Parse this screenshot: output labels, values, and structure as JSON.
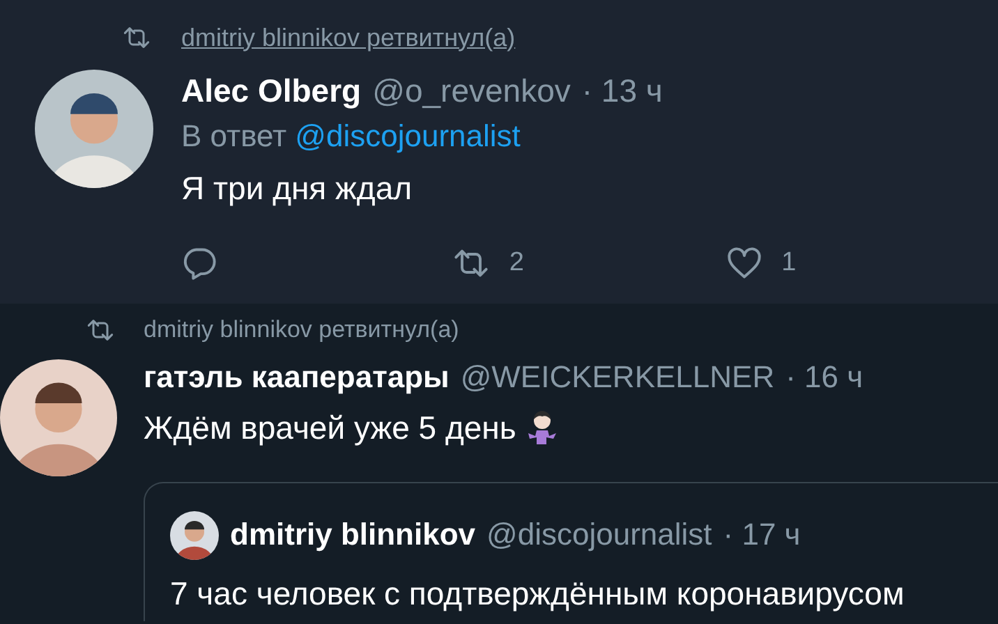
{
  "tweets": [
    {
      "retweeted_by": "dmitriy blinnikov ретвитнул(а)",
      "hovered": true,
      "name": "Alec Olberg",
      "handle": "@o_revenkov",
      "time": "· 13 ч",
      "reply_prefix": "В ответ",
      "reply_to": "@discojournalist",
      "text": "Я три дня ждал",
      "actions": [
        {
          "kind": "reply"
        },
        {
          "kind": "retweet",
          "count": "2"
        },
        {
          "kind": "like",
          "count": "1"
        }
      ]
    },
    {
      "retweeted_by": "dmitriy blinnikov ретвитнул(а)",
      "hovered": false,
      "name": "гатэль кааператары",
      "handle": "@WEICKERKELLNER",
      "time": "· 16 ч",
      "text": "Ждём врачей уже 5 день",
      "trailing_emoji": true,
      "quote": {
        "name": "dmitriy blinnikov",
        "handle": "@discojournalist",
        "time": "· 17 ч",
        "text": "7 час человек с подтверждённым коронавирусом"
      }
    }
  ]
}
